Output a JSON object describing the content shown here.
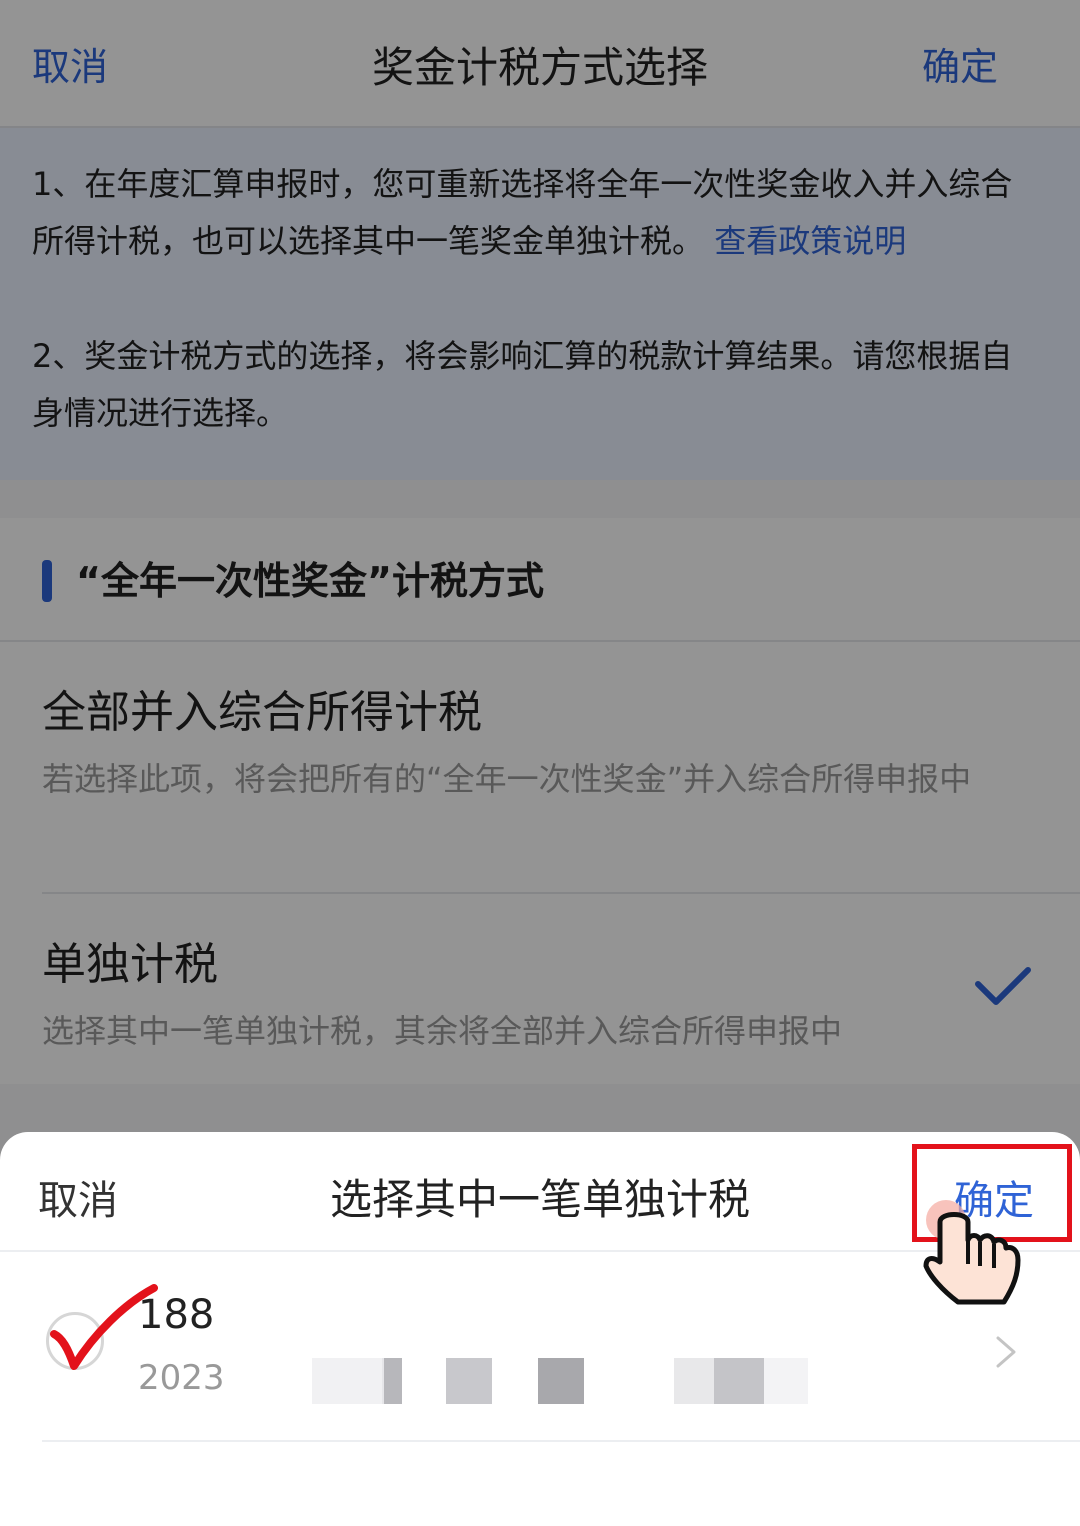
{
  "header": {
    "cancel": "取消",
    "title": "奖金计税方式选择",
    "confirm": "确定"
  },
  "notice": {
    "line1": "1、在年度汇算申报时，您可重新选择将全年一次性奖金收入并入综合所得计税，也可以选择其中一笔奖金单独计税。",
    "link": "查看政策说明",
    "line2": "2、奖金计税方式的选择，将会影响汇算的税款计算结果。请您根据自身情况进行选择。"
  },
  "section": {
    "title": "“全年一次性奖金”计税方式",
    "options": [
      {
        "name": "全部并入综合所得计税",
        "desc": "若选择此项，将会把所有的“全年一次性奖金”并入综合所得申报中"
      },
      {
        "name": "单独计税",
        "desc": "选择其中一笔单独计税，其余将全部并入综合所得申报中",
        "selected": true
      }
    ]
  },
  "sheet": {
    "cancel": "取消",
    "title": "选择其中一笔单独计税",
    "confirm": "确定",
    "item": {
      "amount": "188",
      "date": "2023"
    }
  },
  "colors": {
    "accent": "#2f63d6",
    "highlight": "#e3121b",
    "overlay": "rgba(0,0,0,0.42)"
  },
  "icons": [
    "check-icon",
    "chevron-right-icon",
    "red-check-annotation-icon",
    "tap-hand-icon"
  ]
}
